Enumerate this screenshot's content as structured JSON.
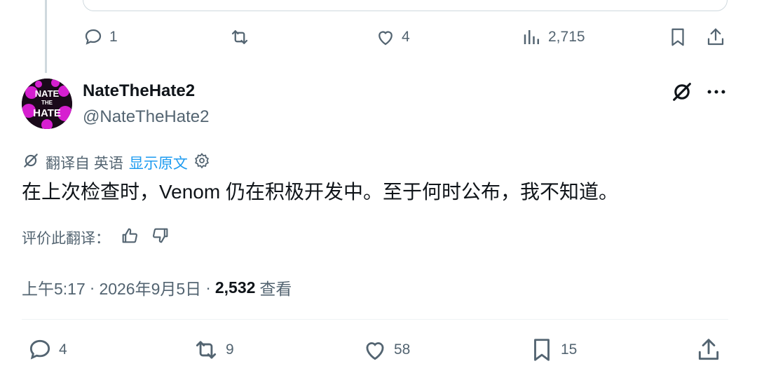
{
  "prev_tweet": {
    "actions": {
      "reply_count": "1",
      "like_count": "4",
      "views_count": "2,715"
    }
  },
  "tweet": {
    "author_name": "NateTheHate2",
    "author_handle": "@NateTheHate2",
    "avatar_lines": [
      "NATE",
      "THE",
      "HATE"
    ],
    "translation": {
      "label": "翻译自 英语",
      "show_original": "显示原文"
    },
    "text": "在上次检查时，Venom 仍在积极开发中。至于何时公布，我不知道。",
    "rate_label": "评价此翻译：",
    "time": "上午5:17",
    "date": "2026年9月5日",
    "separator": "·",
    "views_count": "2,532",
    "views_label": "查看",
    "actions": {
      "reply_count": "4",
      "retweet_count": "9",
      "like_count": "58",
      "bookmark_count": "15"
    }
  },
  "colors": {
    "text_primary": "#0f1419",
    "text_secondary": "#536471",
    "link": "#1d9bf0",
    "avatar_accent": "#d61fd0"
  }
}
